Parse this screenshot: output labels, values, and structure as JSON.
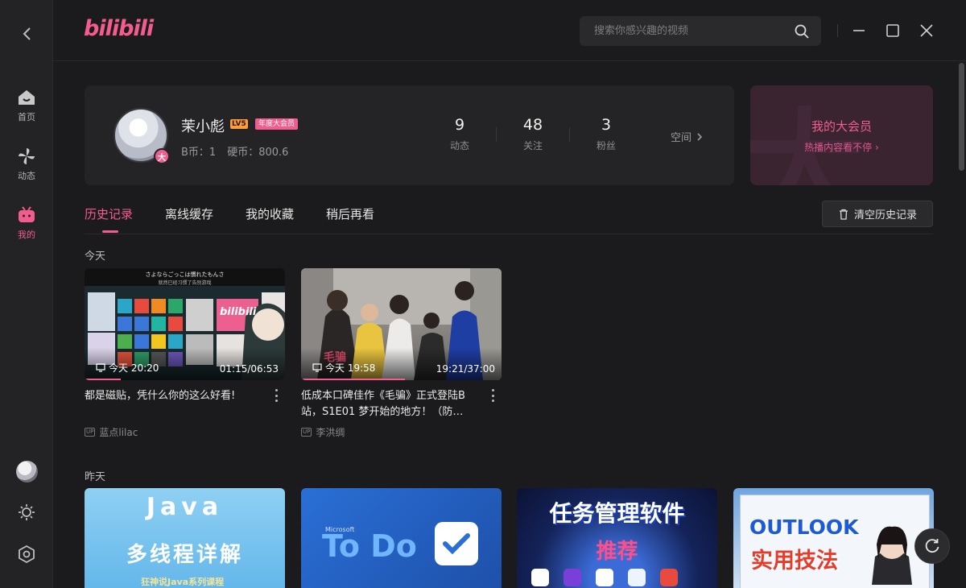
{
  "app": {
    "logo": "bilibili"
  },
  "sidebar": {
    "items": [
      {
        "label": "首页",
        "icon": "home-icon"
      },
      {
        "label": "动态",
        "icon": "pinwheel-icon"
      },
      {
        "label": "我的",
        "icon": "tv-icon"
      }
    ]
  },
  "search": {
    "placeholder": "搜索你感兴趣的视频"
  },
  "profile": {
    "name": "茉小彪",
    "level": "LV5",
    "vip_tag": "年度大会员",
    "avatar_badge": "大",
    "b_coin": "B币：1",
    "coin": "硬币：800.6",
    "stats": [
      {
        "value": "9",
        "label": "动态"
      },
      {
        "value": "48",
        "label": "关注"
      },
      {
        "value": "3",
        "label": "粉丝"
      }
    ],
    "space_label": "空间"
  },
  "vip_card": {
    "bg_char": "大",
    "title": "我的大会员",
    "subtitle": "热播内容看不停"
  },
  "tabs": [
    "历史记录",
    "离线缓存",
    "我的收藏",
    "稍后再看"
  ],
  "clear_button": "清空历史记录",
  "sections": {
    "today": {
      "title": "今天",
      "videos": [
        {
          "watched": "今天 20:20",
          "duration": "01:15/06:53",
          "progress": 0.18,
          "title": "都是磁贴，凭什么你的这么好看!",
          "up": "蓝点lilac",
          "thumb_text": "さよならごっこは慣れたもんさ",
          "thumb_sub": "就然已经习惯了告别游戏",
          "thumb_logo": "bilibili"
        },
        {
          "watched": "今天 19:58",
          "duration": "19:21/37:00",
          "progress": 0.52,
          "title": "低成本口碑佳作《毛骗》正式登陆B站，S1E01 梦开始的地方！（防…",
          "up": "李洪绸",
          "thumb_logo": "毛骗"
        }
      ]
    },
    "yesterday": {
      "title": "昨天",
      "videos": [
        {
          "thumb_main": "Java",
          "thumb_sub": "多线程详解",
          "thumb_foot": "狂神说Java系列课程"
        },
        {
          "thumb_tag": "Microsoft",
          "thumb_main": "To Do"
        },
        {
          "thumb_main": "任务管理软件",
          "thumb_sub": "推荐"
        },
        {
          "thumb_main": "OUTLOOK",
          "thumb_sub": "实用技法"
        }
      ]
    }
  }
}
